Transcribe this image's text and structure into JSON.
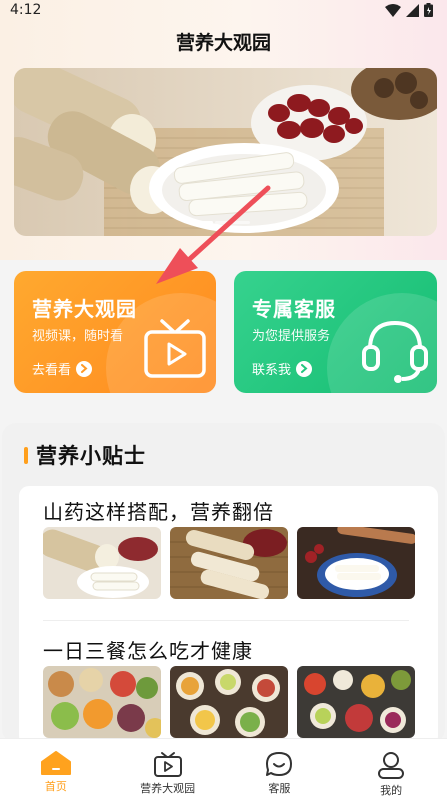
{
  "status": {
    "time": "4:12"
  },
  "header": {
    "title": "营养大观园"
  },
  "feature_cards": [
    {
      "title": "营养大观园",
      "subtitle": "视频课，随时看",
      "link": "去看看",
      "color": "#ff9a26"
    },
    {
      "title": "专属客服",
      "subtitle": "为您提供服务",
      "link": "联系我",
      "color": "#22c77e"
    }
  ],
  "tips": {
    "title": "营养小贴士",
    "articles": [
      {
        "title": "山药这样搭配，营养翻倍"
      },
      {
        "title": "一日三餐怎么吃才健康"
      }
    ]
  },
  "tabbar": {
    "items": [
      {
        "label": "首页",
        "icon": "home-icon",
        "active": true
      },
      {
        "label": "营养大观园",
        "icon": "tv-icon",
        "active": false
      },
      {
        "label": "客服",
        "icon": "chat-icon",
        "active": false
      },
      {
        "label": "我的",
        "icon": "user-icon",
        "active": false
      }
    ]
  },
  "colors": {
    "accent": "#ff9f1c",
    "orange_card": "#ff9a26",
    "green_card": "#22c77e"
  }
}
